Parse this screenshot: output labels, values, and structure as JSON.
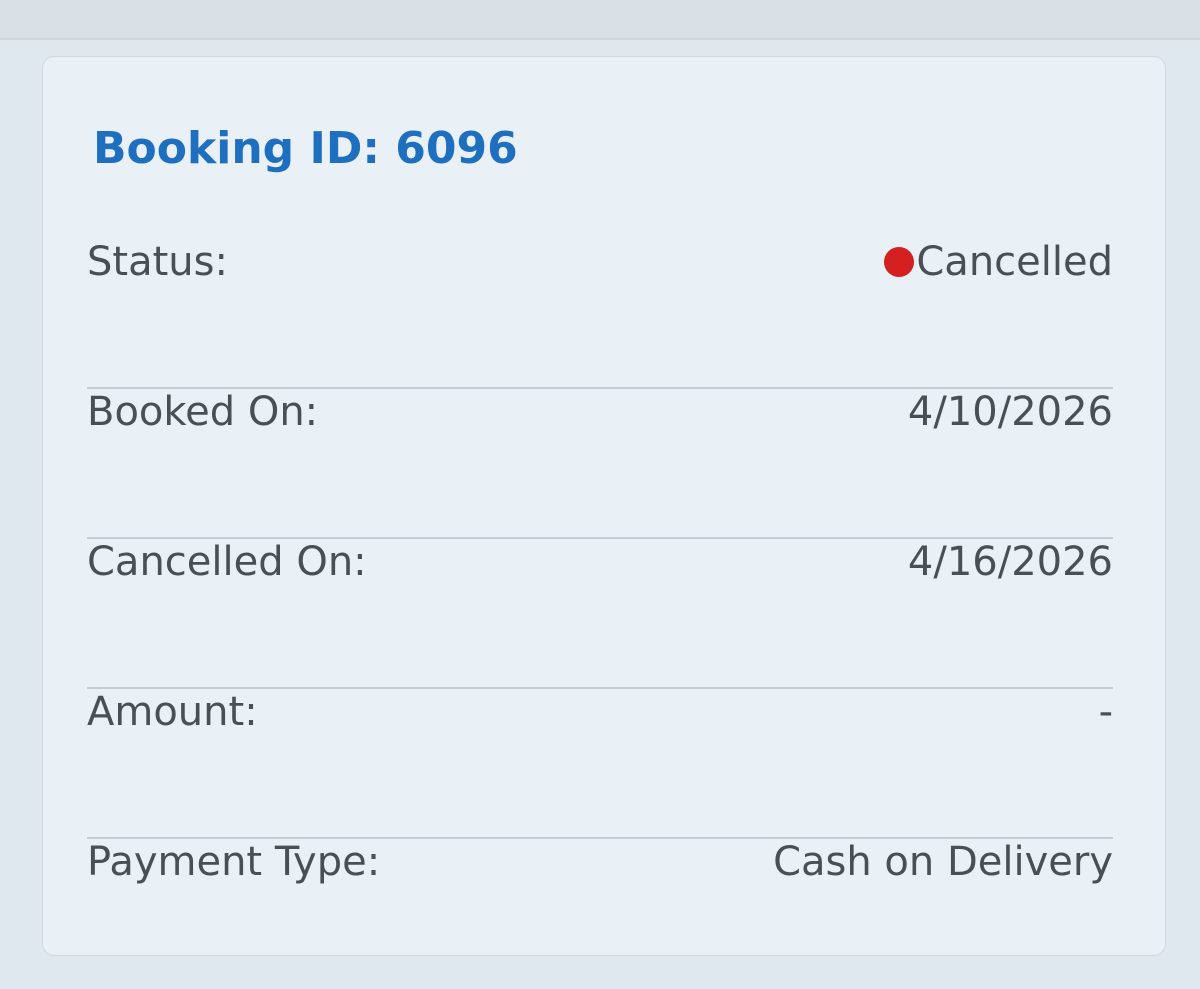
{
  "booking": {
    "title": "Booking ID: 6096",
    "rows": [
      {
        "label": "Status:",
        "value": "Cancelled",
        "status_color": "#d42020"
      },
      {
        "label": "Booked On:",
        "value": "4/10/2026"
      },
      {
        "label": "Cancelled On:",
        "value": "4/16/2026"
      },
      {
        "label": "Amount:",
        "value": "-"
      },
      {
        "label": "Payment Type:",
        "value": "Cash on Delivery"
      }
    ]
  },
  "colors": {
    "title": "#1f6fc0",
    "text": "#4a4f54",
    "divider": "#c4cdd3",
    "card_bg": "#e9f1f6"
  }
}
